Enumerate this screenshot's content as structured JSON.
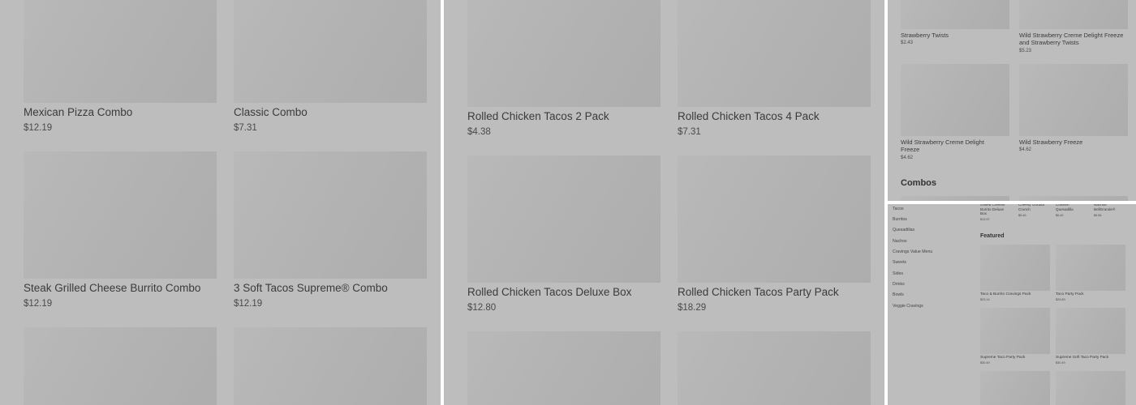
{
  "panel1": {
    "items": [
      {
        "name": "Mexican Pizza Combo",
        "price": "$12.19"
      },
      {
        "name": "Classic Combo",
        "price": "$7.31"
      },
      {
        "name": "Steak Grilled Cheese Burrito Combo",
        "price": "$12.19"
      },
      {
        "name": "3 Soft Tacos Supreme® Combo",
        "price": "$12.19"
      }
    ]
  },
  "panel2": {
    "items": [
      {
        "name": "Rolled Chicken Tacos 2 Pack",
        "price": "$4.38"
      },
      {
        "name": "Rolled Chicken Tacos 4 Pack",
        "price": "$7.31"
      },
      {
        "name": "Rolled Chicken Tacos Deluxe Box",
        "price": "$12.80"
      },
      {
        "name": "Rolled Chicken Tacos Party Pack",
        "price": "$18.29"
      }
    ]
  },
  "panel3": {
    "items": [
      {
        "name": "Strawberry Twists",
        "price": "$2.43"
      },
      {
        "name": "Wild Strawberry Creme Delight Freeze and Strawberry Twists",
        "price": "$5.23"
      },
      {
        "name": "Wild Strawberry Creme Delight Freeze",
        "price": "$4.62"
      },
      {
        "name": "Wild Strawberry Freeze",
        "price": "$4.62"
      }
    ],
    "section_heading": "Combos"
  },
  "panel4": {
    "sidebar": [
      "Tacos",
      "Burritos",
      "Quesadillas",
      "Nachos",
      "Cravings Value Menu",
      "Sweets",
      "Sides",
      "Drinks",
      "Bowls",
      "Veggie Cravings"
    ],
    "top_items": [
      {
        "name": "Grilled Cheese Burrito Deluxe Box",
        "price": "$13.97"
      },
      {
        "name": "Cheesy Gordita Crunch",
        "price": "$5.46"
      },
      {
        "name": "Chicken Quesadilla",
        "price": "$6.45"
      },
      {
        "name": "Nachos BellGrande®",
        "price": "$6.56"
      }
    ],
    "featured_heading": "Featured",
    "featured": [
      {
        "name": "Taco & Burrito Cravings Pack",
        "price": "$23.14"
      },
      {
        "name": "Taco Party Pack",
        "price": "$26.83"
      },
      {
        "name": "Supreme Taco Party Pack",
        "price": "$30.49"
      },
      {
        "name": "Supreme Soft Taco Party Pack",
        "price": "$30.49"
      }
    ]
  }
}
